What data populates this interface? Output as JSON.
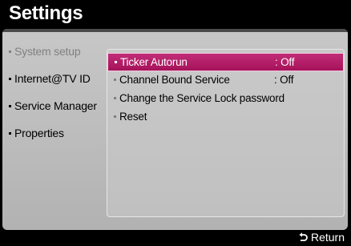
{
  "window": {
    "title": "Settings"
  },
  "side_menu": {
    "items": [
      {
        "label": "System setup",
        "active": false
      },
      {
        "label": "Internet@TV ID",
        "active": true
      },
      {
        "label": "Service Manager",
        "active": true
      },
      {
        "label": "Properties",
        "active": true
      }
    ]
  },
  "sub_menu": {
    "items": [
      {
        "label": "Ticker Autorun",
        "value": ": Off",
        "selected": true
      },
      {
        "label": "Channel Bound Service",
        "value": ": Off",
        "selected": false
      },
      {
        "label": "Change the Service Lock password",
        "value": "",
        "selected": false
      },
      {
        "label": "Reset",
        "value": "",
        "selected": false
      }
    ]
  },
  "footer": {
    "return_label": "Return",
    "return_icon": "return-arrow-icon"
  },
  "colors": {
    "highlight": "#b01e66",
    "panel": "#c2c2c2",
    "background": "#000000",
    "disabled_text": "#808080"
  }
}
